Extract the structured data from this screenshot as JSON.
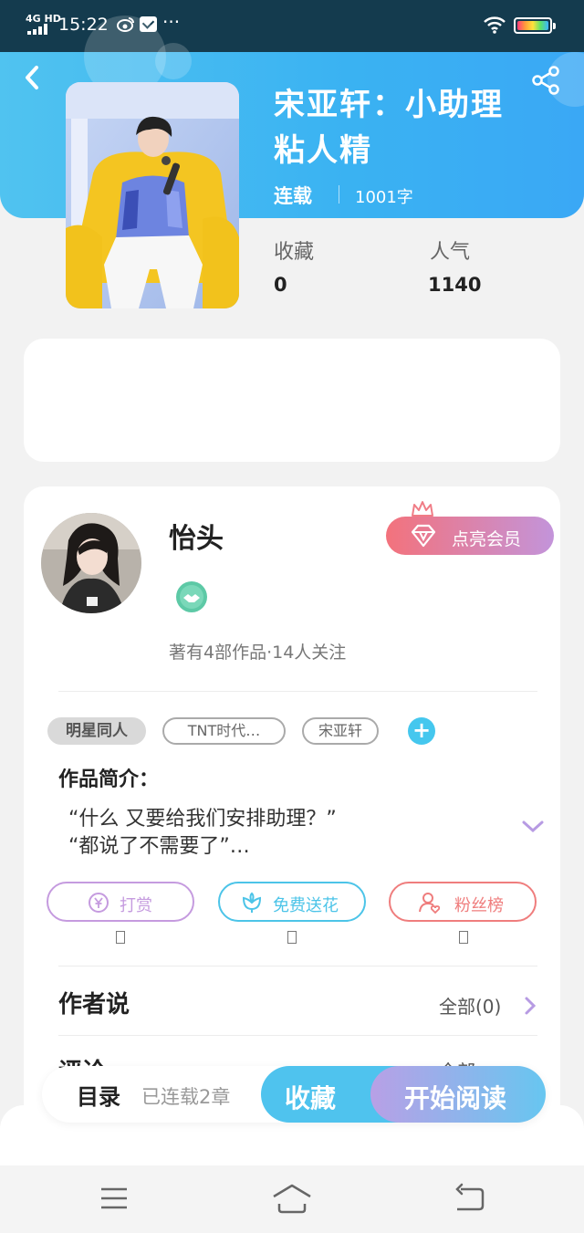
{
  "status_bar": {
    "network": "4G HD",
    "time": "15:22",
    "more": "···"
  },
  "book": {
    "title_line1": "宋亚轩：小助理",
    "title_line2": "粘人精",
    "status": "连载",
    "word_count": "1001字",
    "stats": [
      {
        "label": "收藏",
        "value": "0"
      },
      {
        "label": "人气",
        "value": "1140"
      }
    ]
  },
  "author": {
    "name": "怡头",
    "meta": "著有4部作品·14人关注",
    "vip_button": "点亮会员"
  },
  "tags": [
    "明星同人",
    "TNT时代…",
    "宋亚轩"
  ],
  "tag_add": "+",
  "intro": {
    "label": "作品简介：",
    "line1": "“什么 又要给我们安排助理？”",
    "line2": "“都说了不需要了”…"
  },
  "actions": [
    {
      "label": "打赏",
      "icon": "yen-icon",
      "color": "#c59bdf"
    },
    {
      "label": "免费送花",
      "icon": "flower-icon",
      "color": "#4cc4e8"
    },
    {
      "label": "粉丝榜",
      "icon": "user-heart-icon",
      "color": "#ef7d7d"
    }
  ],
  "author_says": {
    "title": "作者说",
    "link": "全部(0)"
  },
  "comments": {
    "title": "评论",
    "link": "全部"
  },
  "bottom_bar": {
    "toc": "目录",
    "toc_status": "已连载2章",
    "favorite": "收藏",
    "start_reading": "开始阅读"
  },
  "colors": {
    "header_blue": "#3ab2f2",
    "accent_cyan": "#4fc3ee",
    "accent_purple": "#b8a0e6",
    "vip_start": "#f3727c",
    "vip_end": "#c394da"
  }
}
